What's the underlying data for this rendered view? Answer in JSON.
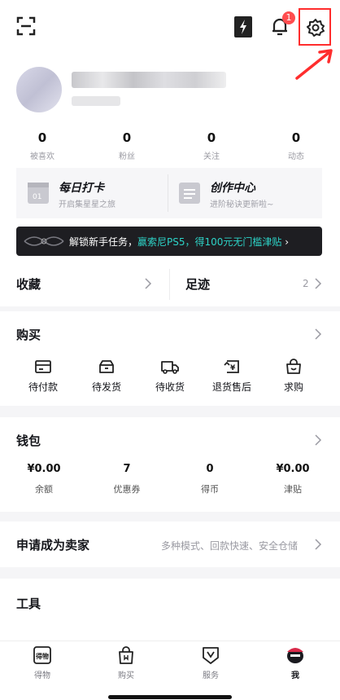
{
  "header": {
    "notification_count": "1",
    "accent_color": "#ff2d2d"
  },
  "stats": [
    {
      "value": "0",
      "label": "被喜欢"
    },
    {
      "value": "0",
      "label": "粉丝"
    },
    {
      "value": "0",
      "label": "关注"
    },
    {
      "value": "0",
      "label": "动态"
    }
  ],
  "cards": [
    {
      "title": "每日打卡",
      "subtitle": "开启集星星之旅",
      "icon": "calendar-icon"
    },
    {
      "title": "创作中心",
      "subtitle": "进阶秘诀更新啦~",
      "icon": "document-icon"
    }
  ],
  "banner": {
    "prefix": "解锁新手任务，",
    "highlight": "赢索尼PS5，得100元无门槛津贴",
    "chevron": "›"
  },
  "favorites": {
    "label": "收藏"
  },
  "footprints": {
    "label": "足迹",
    "count": "2"
  },
  "purchase": {
    "title": "购买",
    "items": [
      {
        "label": "待付款",
        "icon": "card-icon"
      },
      {
        "label": "待发货",
        "icon": "box-icon"
      },
      {
        "label": "待收货",
        "icon": "truck-icon"
      },
      {
        "label": "退货售后",
        "icon": "return-icon"
      },
      {
        "label": "求购",
        "icon": "bag-icon"
      }
    ]
  },
  "wallet": {
    "title": "钱包",
    "items": [
      {
        "value": "¥0.00",
        "label": "余额"
      },
      {
        "value": "7",
        "label": "优惠券"
      },
      {
        "value": "0",
        "label": "得币"
      },
      {
        "value": "¥0.00",
        "label": "津贴"
      }
    ]
  },
  "seller": {
    "title": "申请成为卖家",
    "hint": "多种模式、回款快速、安全仓储"
  },
  "tools": {
    "title": "工具"
  },
  "tabbar": {
    "items": [
      {
        "label": "得物",
        "icon": "dewu-icon"
      },
      {
        "label": "购买",
        "icon": "shopping-bag-icon"
      },
      {
        "label": "服务",
        "icon": "service-icon"
      },
      {
        "label": "我",
        "icon": "me-avatar-icon"
      }
    ],
    "active": "我"
  }
}
